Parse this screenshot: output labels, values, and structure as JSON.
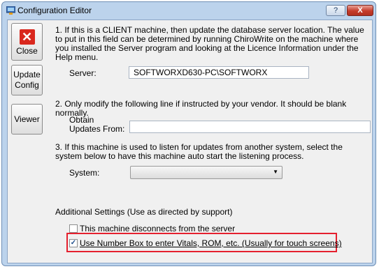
{
  "window": {
    "title": "Configuration Editor",
    "help_label": "?",
    "close_label": "X"
  },
  "sidebar": {
    "close_label": "Close",
    "update_label": "Update Config",
    "viewer_label": "Viewer"
  },
  "section1": {
    "text": "1. If this is a CLIENT machine, then update the database server location.   The value to put in this field can be determined by running ChiroWrite on the machine where you installed the Server program and looking at the Licence Information under the Help menu.",
    "server_label": "Server:",
    "server_value": "SOFTWORXD630-PC\\SOFTWORX"
  },
  "section2": {
    "text": "2. Only modify the following line if instructed by your vendor.  It should be blank normally.",
    "obtain_label": "Obtain\nUpdates From:",
    "obtain_value": ""
  },
  "section3": {
    "text": "3. If this machine is used to listen for updates from another system, select the system below to have this machine auto start the listening process.",
    "system_label": "System:",
    "system_value": ""
  },
  "additional": {
    "heading": "Additional Settings (Use as directed by support)",
    "option_disconnect": "This machine disconnects from the server",
    "option_disconnect_checked": false,
    "option_numberbox": "Use Number Box to enter Vitals, ROM, etc. (Usually for touch screens)",
    "option_numberbox_checked": true
  },
  "colors": {
    "highlight": "#e5202e",
    "frame": "#bcd3ec"
  }
}
